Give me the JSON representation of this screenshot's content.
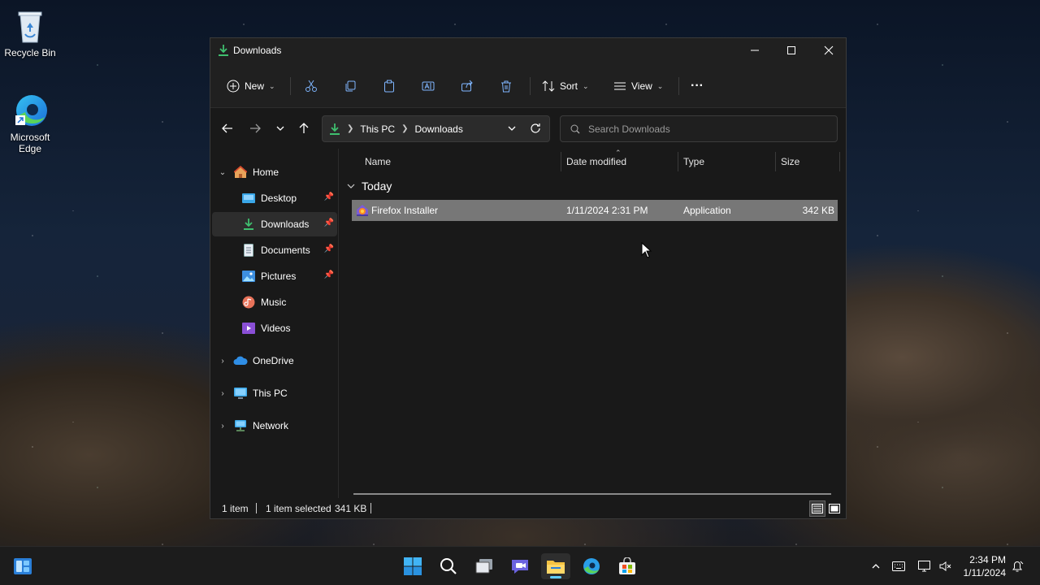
{
  "desktop": {
    "icons": [
      {
        "label": "Recycle Bin"
      },
      {
        "label": "Microsoft Edge"
      }
    ]
  },
  "window": {
    "title": "Downloads"
  },
  "toolbar": {
    "new_label": "New",
    "sort_label": "Sort",
    "view_label": "View",
    "more_label": "···"
  },
  "address": {
    "crumbs": [
      "This PC",
      "Downloads"
    ]
  },
  "search": {
    "placeholder": "Search Downloads"
  },
  "sidebar": {
    "quick": [
      {
        "label": "Home"
      },
      {
        "label": "Desktop"
      },
      {
        "label": "Downloads"
      },
      {
        "label": "Documents"
      },
      {
        "label": "Pictures"
      },
      {
        "label": "Music"
      },
      {
        "label": "Videos"
      }
    ],
    "drives": [
      {
        "label": "OneDrive"
      },
      {
        "label": "This PC"
      },
      {
        "label": "Network"
      }
    ]
  },
  "columns": {
    "name": "Name",
    "date": "Date modified",
    "type": "Type",
    "size": "Size"
  },
  "group": {
    "label": "Today"
  },
  "files": [
    {
      "name": "Firefox Installer",
      "date": "1/11/2024 2:31 PM",
      "type": "Application",
      "size": "342 KB"
    }
  ],
  "status": {
    "count": "1 item",
    "selected": "1 item selected",
    "selected_size": "341 KB"
  },
  "taskbar": {
    "time": "2:34 PM",
    "date": "1/11/2024"
  },
  "colors": {
    "accent": "#60cdff",
    "selection": "#777777",
    "download_green": "#3fbf6f"
  }
}
